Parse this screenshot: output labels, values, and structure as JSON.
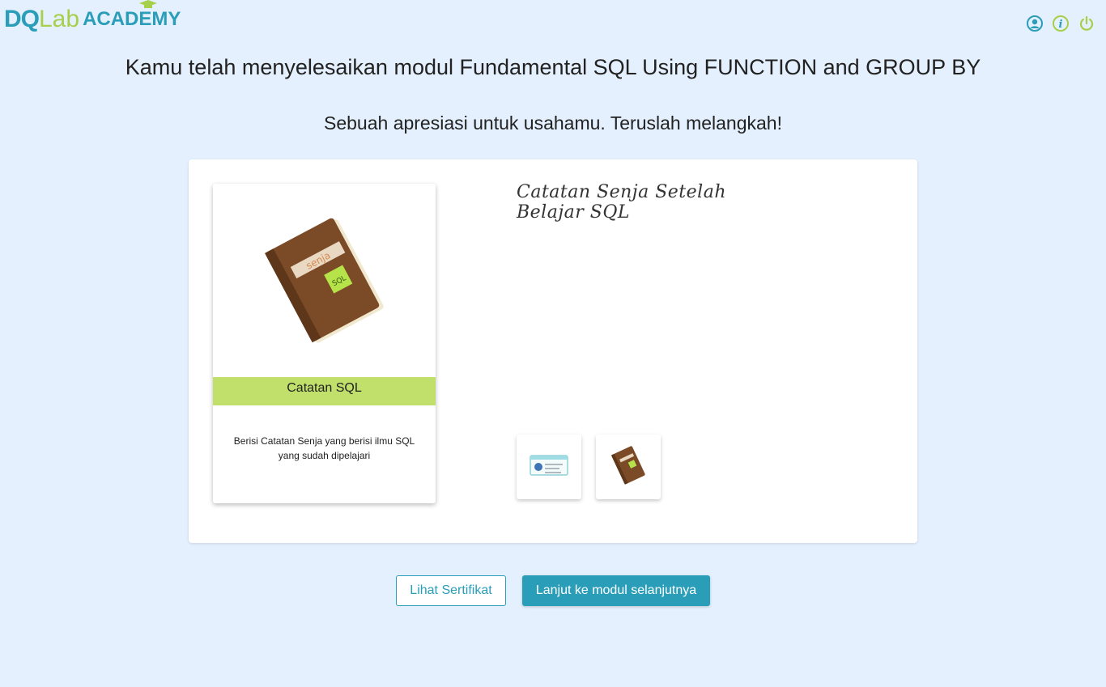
{
  "brand": {
    "logo_part1": "DQ",
    "logo_part2": "Lab",
    "logo_part3": "ACADEMY"
  },
  "header_icons": [
    "user-icon",
    "info-icon",
    "power-icon"
  ],
  "completion": {
    "title": "Kamu telah menyelesaikan modul Fundamental SQL Using FUNCTION and GROUP BY",
    "subtitle": "Sebuah apresiasi untuk usahamu. Teruslah melangkah!"
  },
  "reward_card": {
    "label": "Catatan SQL",
    "description": "Berisi Catatan Senja yang berisi ilmu SQL yang sudah dipelajari",
    "book_stamp": "senja",
    "sticky_note": "SQL"
  },
  "notes_panel": {
    "title": "Catatan Senja Setelah Belajar SQL"
  },
  "thumbnails": [
    "certificate-thumbnail",
    "book-thumbnail"
  ],
  "actions": {
    "certificate_button": "Lihat Sertifikat",
    "next_module_button": "Lanjut ke modul selanjutnya"
  },
  "colors": {
    "background": "#e4f0fd",
    "accent_teal": "#2a9db8",
    "accent_green": "#c0df6b",
    "book_brown": "#7b4a26"
  }
}
